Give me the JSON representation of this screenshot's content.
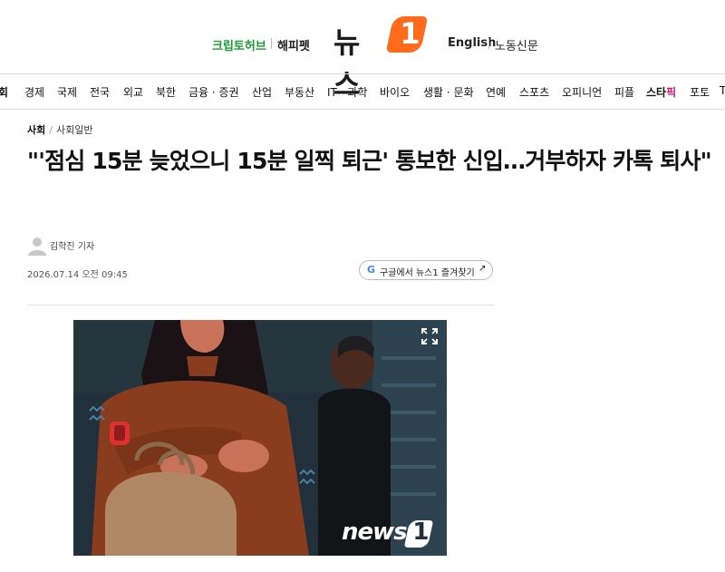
{
  "header": {
    "left_links": [
      "크립토허브",
      "해피펫"
    ],
    "logo_text": "뉴스",
    "logo_badge": "1",
    "right_links": [
      "English",
      "노동신문"
    ]
  },
  "nav": {
    "items": [
      "회",
      "경제",
      "국제",
      "전국",
      "외교",
      "북한",
      "금융 · 증권",
      "산업",
      "부동산",
      "IT · 과학",
      "바이오",
      "생활 · 문화",
      "연예",
      "스포츠",
      "오피니언",
      "피플"
    ],
    "star_main": "스타",
    "star_accent": "픽",
    "tail_items": [
      "포토",
      "T"
    ]
  },
  "article": {
    "breadcrumb": [
      "사회",
      "사회일반"
    ],
    "breadcrumb_sep": "/",
    "headline": "\"'점심 15분 늦었으니 15분 일찍 퇴근' 통보한 신입…거부하자 카톡 퇴사\"",
    "author": "김학진 기자",
    "date": "2026.07.14 오전 09:45",
    "bookmark_icon": "G",
    "bookmark_label": "구글에서 뉴스1 즐겨찾기",
    "bookmark_arrow": "↗",
    "photo_watermark": "news",
    "photo_watermark_badge": "1"
  },
  "colors": {
    "brand_orange": "#ff6b1a",
    "green_link": "#1a9c32",
    "star_pink": "#e0156b",
    "photo_bg": "#22303c",
    "sweater": "#8a3d1e",
    "watch": "#e03030"
  }
}
